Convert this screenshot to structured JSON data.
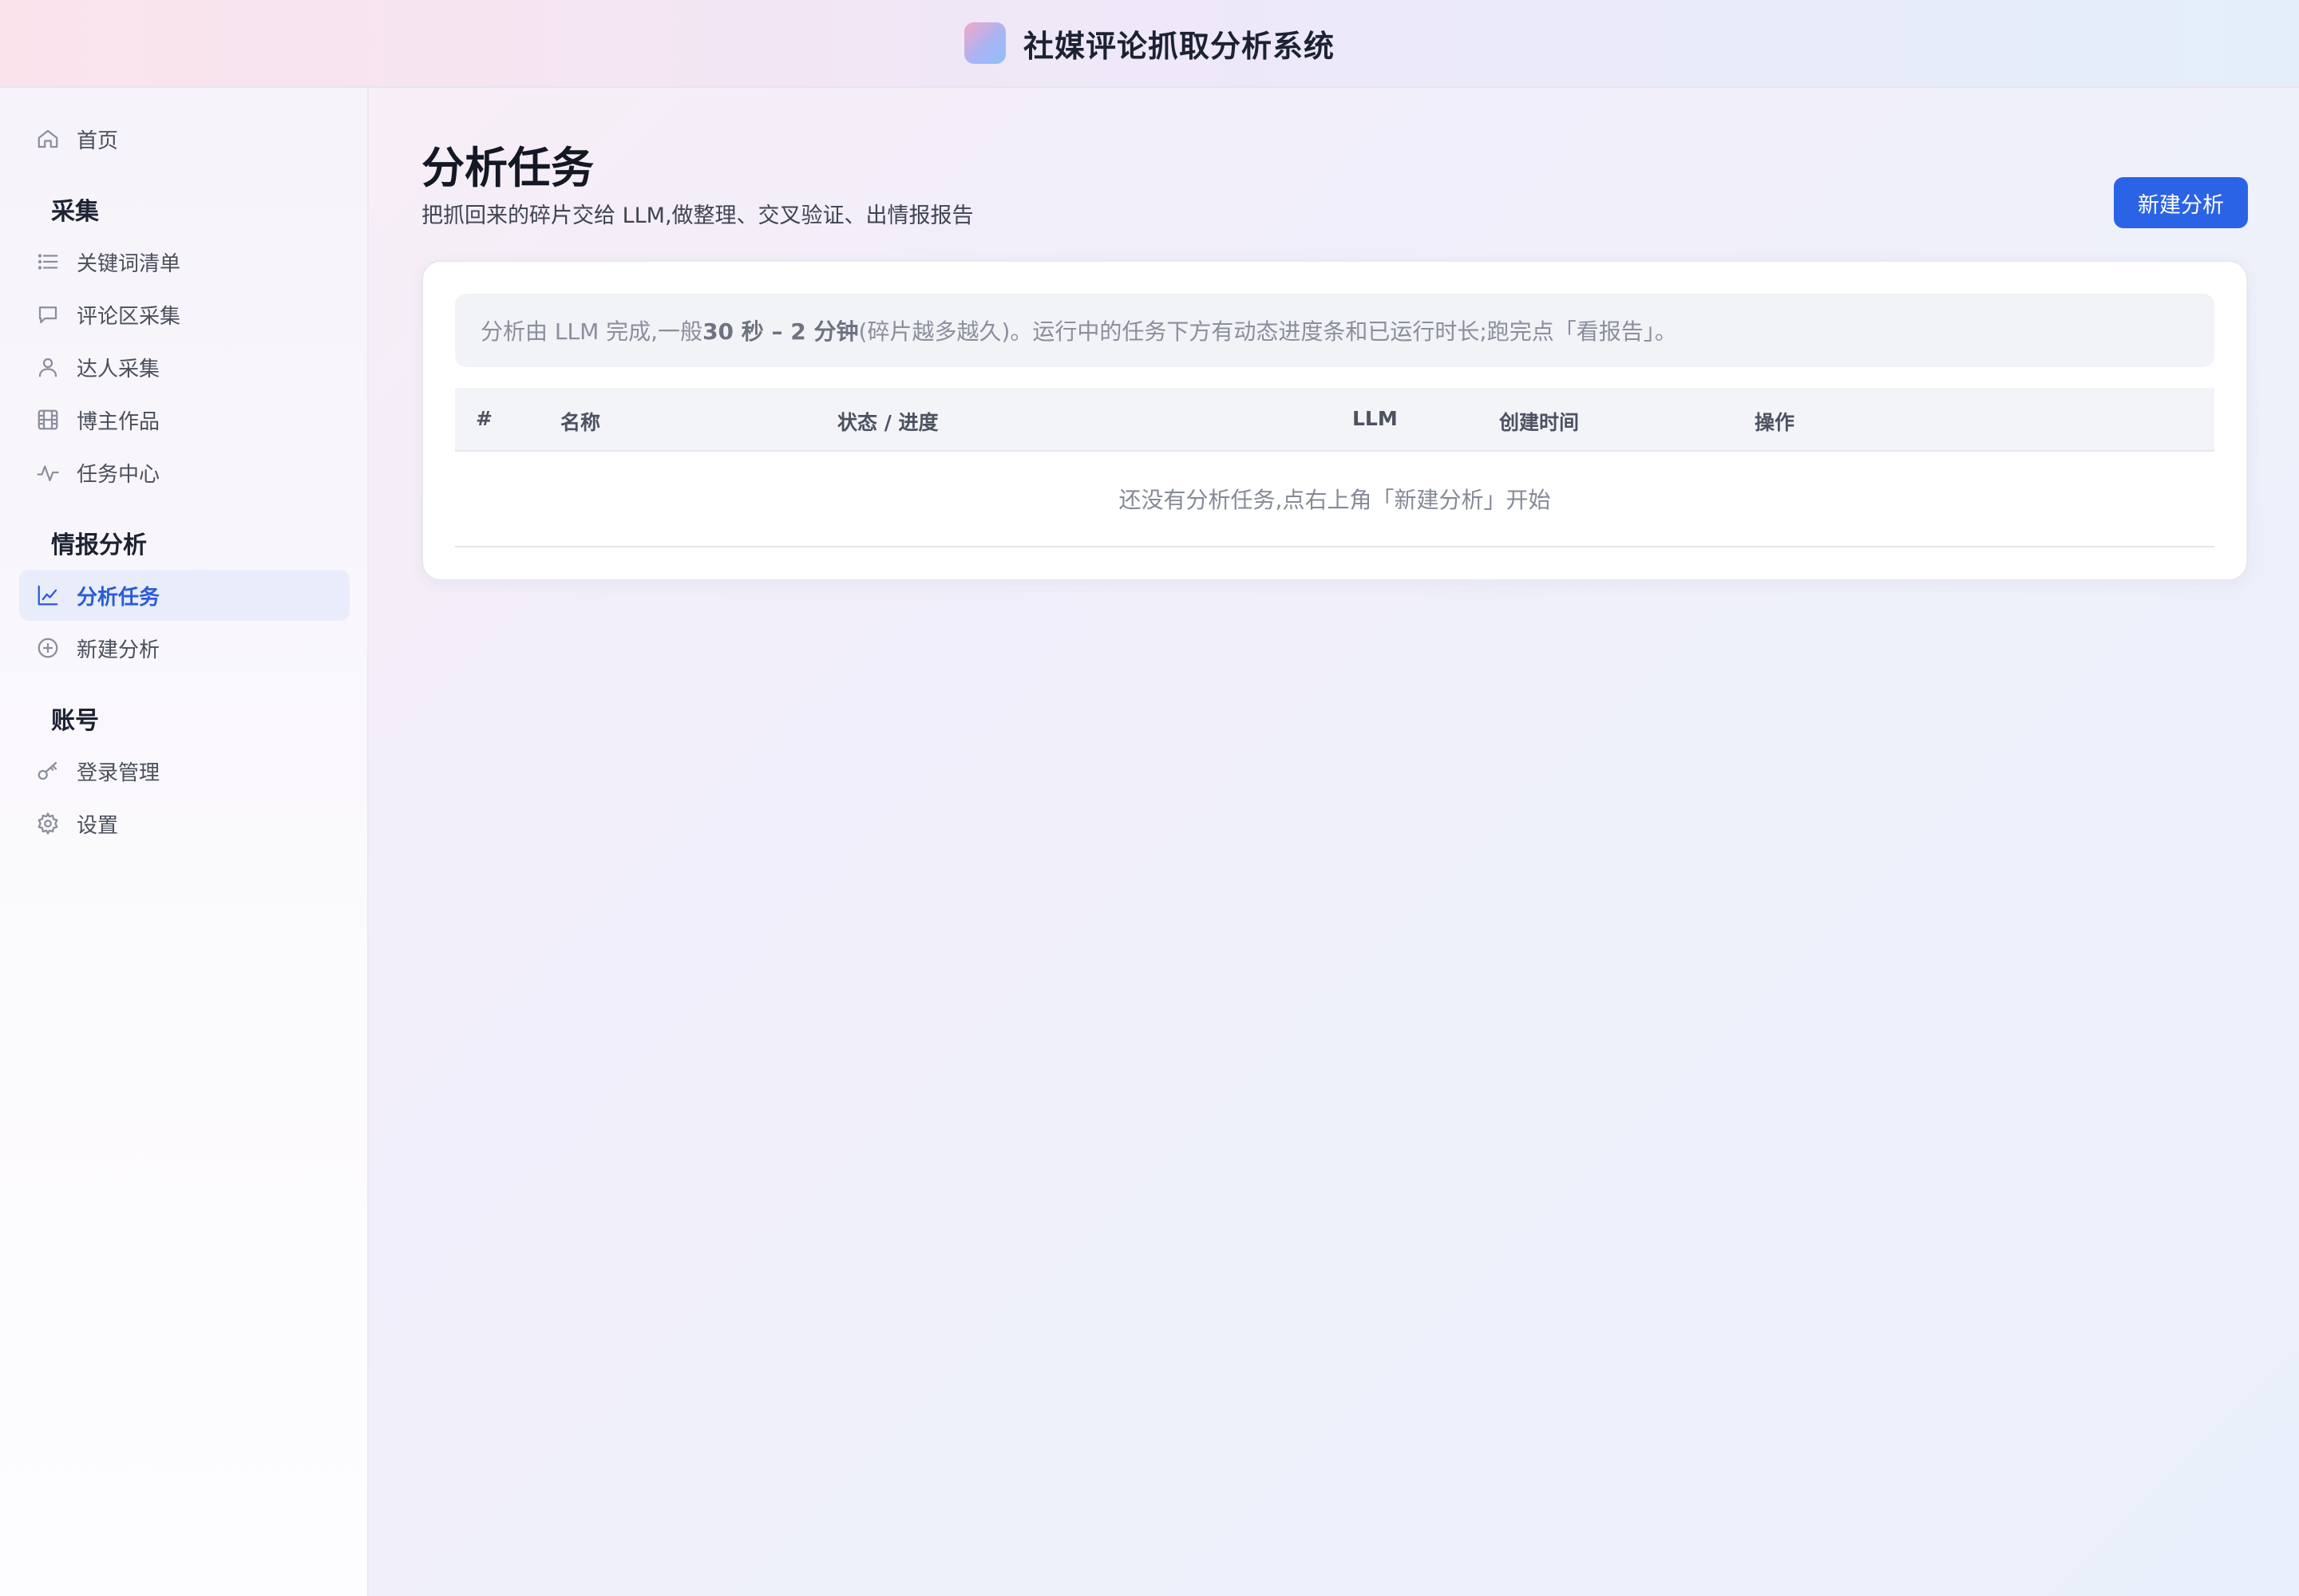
{
  "app": {
    "title": "社媒评论抓取分析系统"
  },
  "sidebar": {
    "home": {
      "label": "首页",
      "icon": "home-icon"
    },
    "sections": [
      {
        "title": "采集",
        "items": [
          {
            "label": "关键词清单",
            "icon": "list-icon"
          },
          {
            "label": "评论区采集",
            "icon": "message-icon"
          },
          {
            "label": "达人采集",
            "icon": "user-icon"
          },
          {
            "label": "博主作品",
            "icon": "film-icon"
          },
          {
            "label": "任务中心",
            "icon": "activity-icon"
          }
        ]
      },
      {
        "title": "情报分析",
        "items": [
          {
            "label": "分析任务",
            "icon": "line-chart-icon",
            "active": true
          },
          {
            "label": "新建分析",
            "icon": "plus-circle-icon"
          }
        ]
      },
      {
        "title": "账号",
        "items": [
          {
            "label": "登录管理",
            "icon": "key-icon"
          },
          {
            "label": "设置",
            "icon": "gear-icon"
          }
        ]
      }
    ]
  },
  "page": {
    "title": "分析任务",
    "subtitle": "把抓回来的碎片交给 LLM,做整理、交叉验证、出情报报告",
    "new_button": "新建分析"
  },
  "notice": {
    "prefix": "分析由 LLM 完成,一般 ",
    "emphasis": "30 秒 – 2 分钟",
    "suffix": "(碎片越多越久)。运行中的任务下方有动态进度条和已运行时长;跑完点「看报告」。"
  },
  "table": {
    "columns": [
      "#",
      "名称",
      "状态 / 进度",
      "LLM",
      "创建时间",
      "操作"
    ],
    "empty_text": "还没有分析任务,点右上角「新建分析」开始"
  },
  "colors": {
    "accent": "#2b63e6",
    "active_bg": "#e8ecfb"
  }
}
